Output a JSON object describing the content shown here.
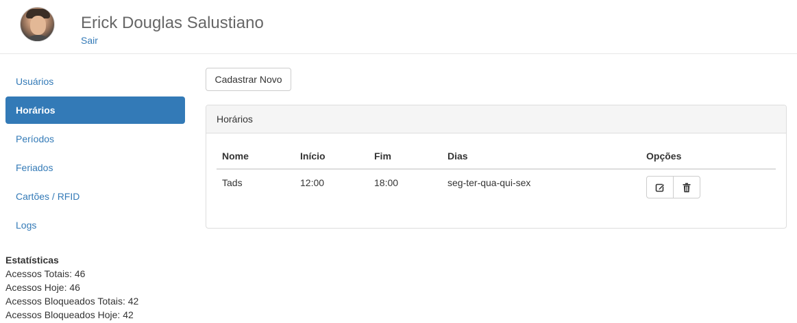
{
  "header": {
    "user_name": "Erick Douglas Salustiano",
    "logout_label": "Sair"
  },
  "sidebar": {
    "items": [
      {
        "label": "Usuários"
      },
      {
        "label": "Horários"
      },
      {
        "label": "Períodos"
      },
      {
        "label": "Feriados"
      },
      {
        "label": "Cartões / RFID"
      },
      {
        "label": "Logs"
      }
    ],
    "active_index": 1
  },
  "stats": {
    "title": "Estatísticas",
    "rows": [
      "Acessos Totais: 46",
      "Acessos Hoje: 46",
      "Acessos Bloqueados Totais: 42",
      "Acessos Bloqueados Hoje: 42"
    ]
  },
  "main": {
    "new_button_label": "Cadastrar Novo",
    "panel_title": "Horários",
    "table": {
      "columns": [
        "Nome",
        "Início",
        "Fim",
        "Dias",
        "Opções"
      ],
      "rows": [
        {
          "nome": "Tads",
          "inicio": "12:00",
          "fim": "18:00",
          "dias": "seg-ter-qua-qui-sex"
        }
      ]
    },
    "icons": {
      "edit": "edit-icon",
      "delete": "trash-icon"
    }
  },
  "colors": {
    "accent": "#337ab7",
    "header_text": "#666666",
    "panel_heading_bg": "#f5f5f5"
  }
}
